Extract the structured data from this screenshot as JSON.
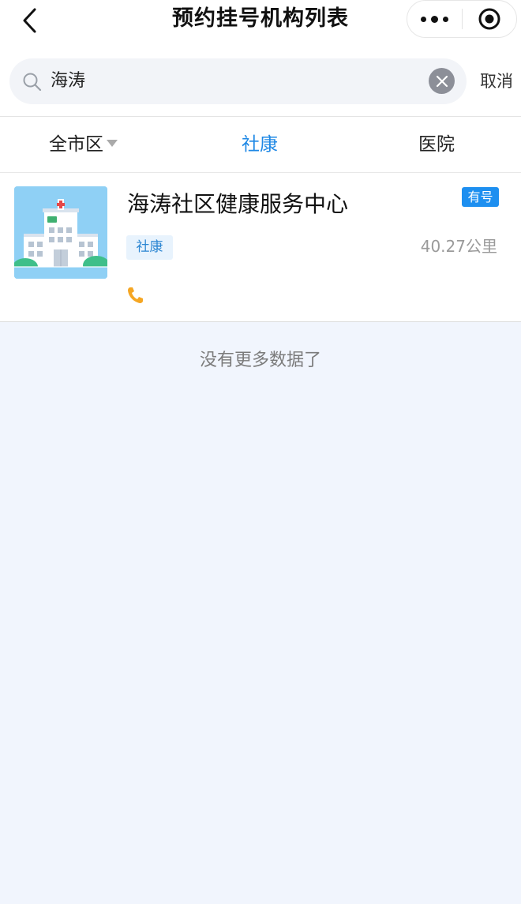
{
  "header": {
    "title": "预约挂号机构列表",
    "back_icon": "chevron-left-icon",
    "more_icon": "more-dots-icon",
    "record_icon": "target-circle-icon"
  },
  "search": {
    "value": "海涛",
    "cancel_label": "取消",
    "icon": "search-icon",
    "clear_icon": "clear-icon"
  },
  "filters": {
    "district": "全市区",
    "community": "社康",
    "hospital": "医院",
    "active": "社康",
    "active_color": "#1e88e5"
  },
  "institutions": [
    {
      "name": "海涛社区健康服务中心",
      "badge": "有号",
      "type_tag": "社康",
      "distance": "40.27公里",
      "phone_icon": "phone-icon",
      "thumbnail": "hospital-building-image"
    }
  ],
  "footer": {
    "no_more_text": "没有更多数据了"
  },
  "colors": {
    "accent": "#1e88e5",
    "badge": "#1d8ff0",
    "tag_bg": "#e8f3fd",
    "phone": "#f5a623",
    "page_bg": "#f1f5fd"
  }
}
